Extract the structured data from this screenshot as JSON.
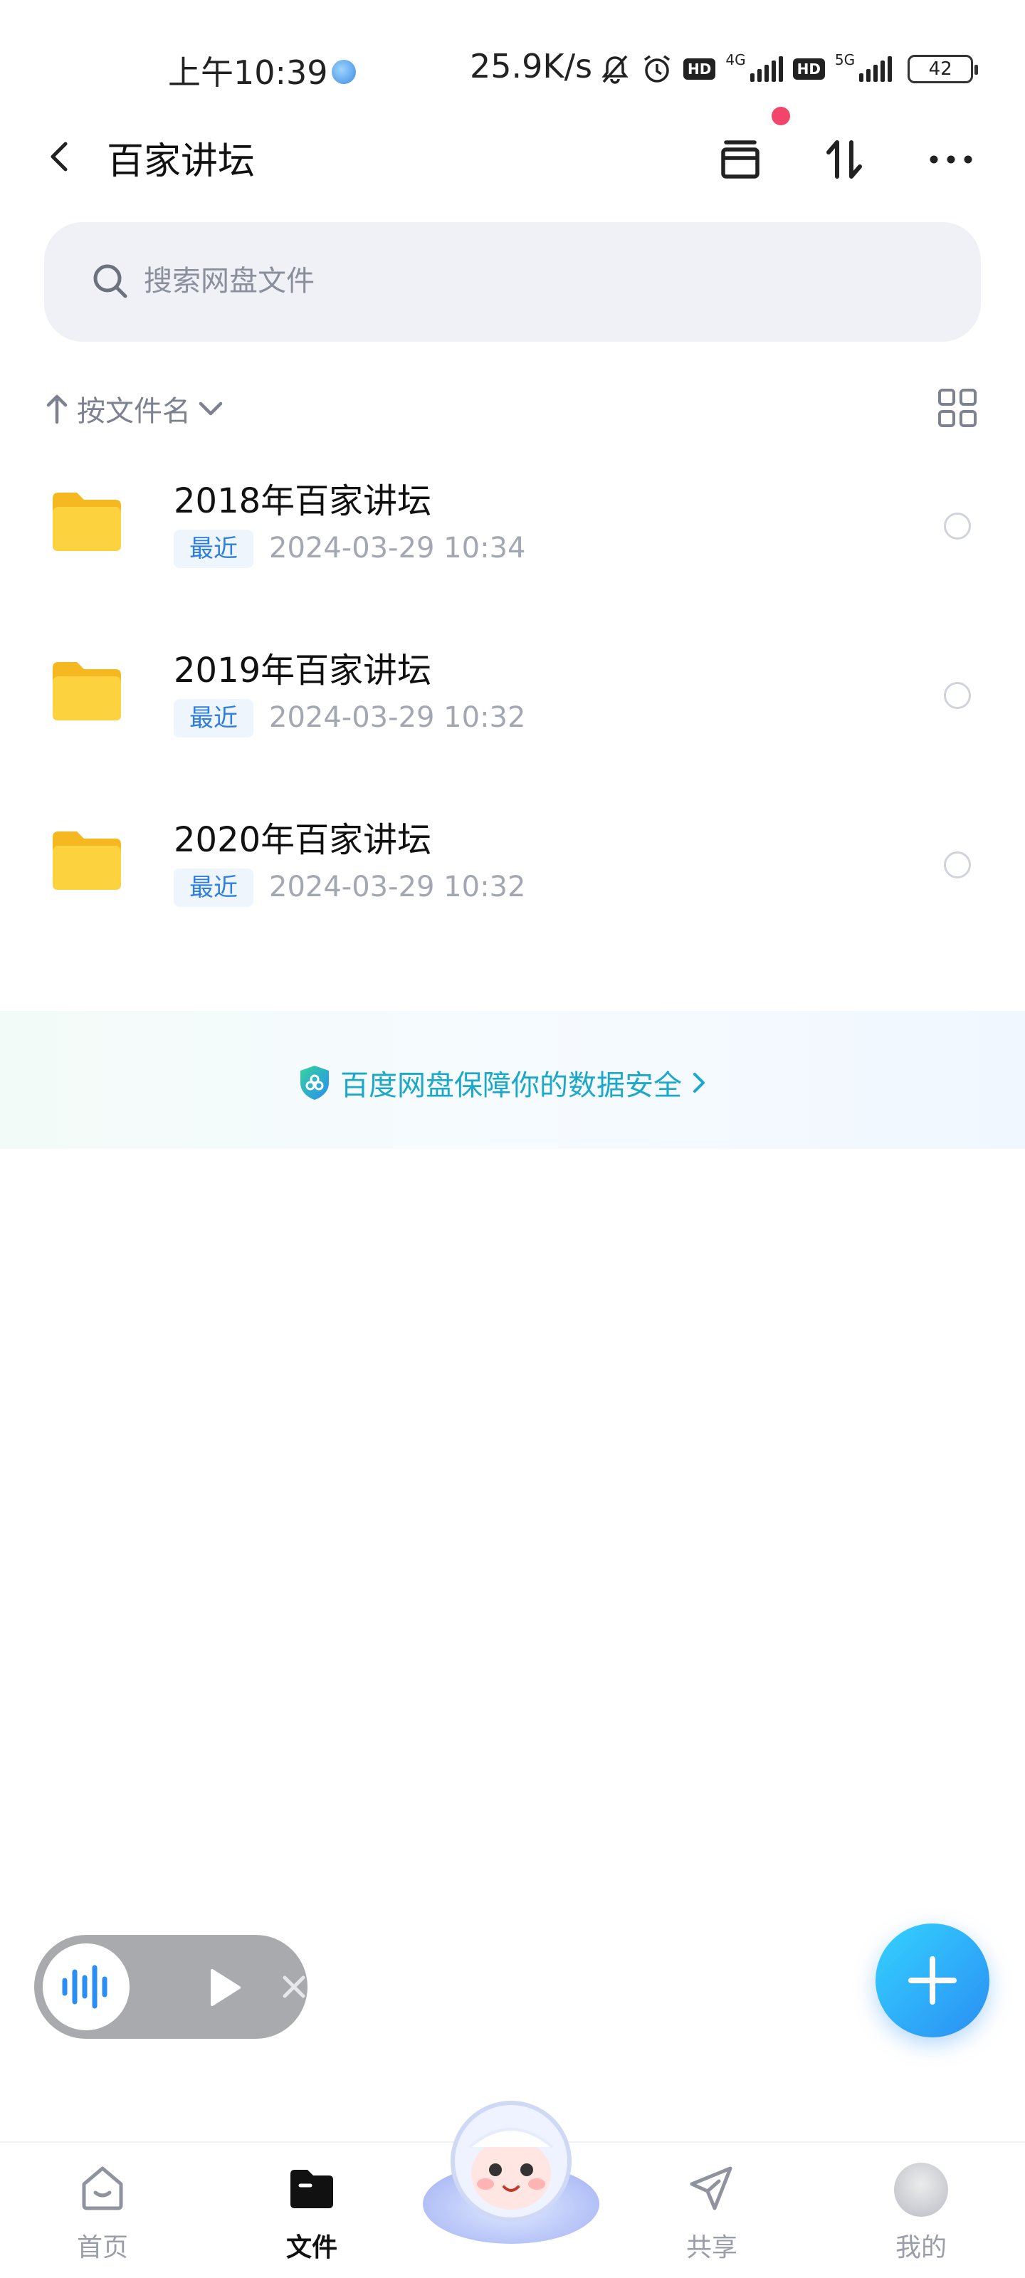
{
  "status_bar": {
    "time": "上午10:39",
    "speed": "25.9K/s",
    "hd1": "HD",
    "net1": "4G",
    "hd2": "HD",
    "net2": "5G",
    "battery": "42"
  },
  "header": {
    "title": "百家讲坛",
    "icons": [
      "back-icon",
      "archive-icon",
      "sort-transfer-icon",
      "more-icon"
    ]
  },
  "search": {
    "placeholder": "搜索网盘文件"
  },
  "sort": {
    "label": "按文件名"
  },
  "files": [
    {
      "name": "2018年百家讲坛",
      "tag": "最近",
      "date": "2024-03-29  10:34"
    },
    {
      "name": "2019年百家讲坛",
      "tag": "最近",
      "date": "2024-03-29  10:32"
    },
    {
      "name": "2020年百家讲坛",
      "tag": "最近",
      "date": "2024-03-29  10:32"
    }
  ],
  "security_banner": {
    "text": "百度网盘保障你的数据安全"
  },
  "bottom_nav": {
    "items": [
      {
        "label": "首页",
        "icon": "home-icon",
        "active": false
      },
      {
        "label": "文件",
        "icon": "folder-icon",
        "active": true
      },
      {
        "label": "共享",
        "icon": "share-icon",
        "active": false
      },
      {
        "label": "我的",
        "icon": "avatar",
        "active": false
      }
    ]
  },
  "colors": {
    "accent": "#2a8ef3",
    "tag_text": "#2d7ee0",
    "security_text": "#1ba8c9",
    "notification_dot": "#f2456b",
    "folder": "#fbcd2d"
  }
}
